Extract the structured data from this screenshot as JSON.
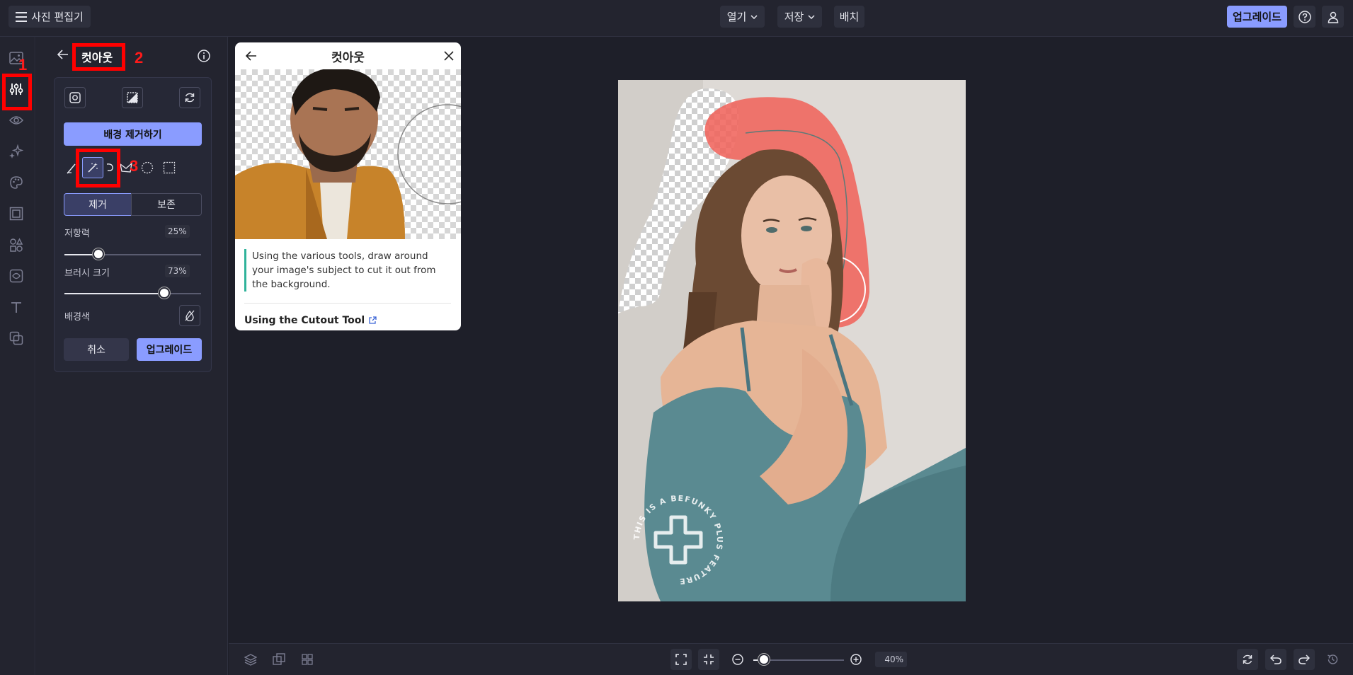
{
  "topbar": {
    "menu_icon": "hamburger-menu-icon",
    "app_title": "사진 편집기",
    "open_label": "열기",
    "save_label": "저장",
    "batch_label": "배치",
    "upgrade_label": "업그레이드"
  },
  "rail": {
    "items": [
      "image-icon",
      "adjust-sliders-icon",
      "eye-icon",
      "sparkle-effects-icon",
      "palette-icon",
      "frame-icon",
      "shapes-icon",
      "texture-icon",
      "text-icon",
      "graphics-icon"
    ]
  },
  "panel": {
    "title": "컷아웃",
    "remove_bg_label": "배경 제거하기",
    "mode_erase": "제거",
    "mode_keep": "보존",
    "tolerance_label": "저항력",
    "tolerance_value": "25%",
    "tolerance_level": 0.25,
    "brush_label": "브러시 크기",
    "brush_value": "73%",
    "brush_level": 0.73,
    "bgcolor_label": "배경색",
    "cancel_label": "취소",
    "upgrade_label": "업그레이드"
  },
  "annotations": {
    "n1": "1",
    "n2": "2",
    "n3": "3"
  },
  "popup": {
    "title": "컷아웃",
    "tip": "Using the various tools, draw around your image's subject to cut it out from the background.",
    "link": "Using the Cutout Tool"
  },
  "watermark": {
    "text": "THIS IS A BEFUNKY PLUS FEATURE"
  },
  "bottombar": {
    "zoom_value": "40%",
    "zoom_level": 0.12
  },
  "colors": {
    "accent": "#8a9cff",
    "background": "#1e1f29",
    "panel": "#23242f",
    "annotation": "#ff0000",
    "mask_overlay": "#f0645c"
  }
}
